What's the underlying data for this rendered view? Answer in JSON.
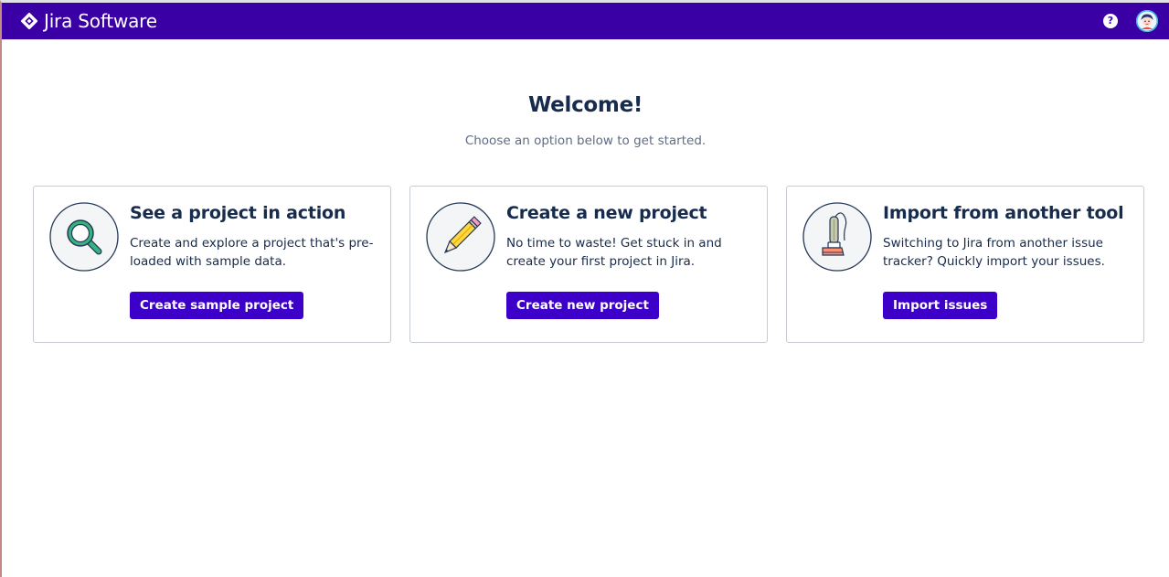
{
  "header": {
    "brand_label": "Jira Software",
    "brand_icon": "jira-diamond-icon",
    "help_icon": "question-circle-icon",
    "help_glyph": "?",
    "avatar_icon": "user-avatar-icon",
    "bar_color": "#3a00a6"
  },
  "main": {
    "title": "Welcome!",
    "subtitle": "Choose an option below to get started.",
    "cards": [
      {
        "icon": "magnifying-glass-icon",
        "title": "See a project in action",
        "description": "Create and explore a project that's pre-loaded with sample data.",
        "button_label": "Create sample project"
      },
      {
        "icon": "pencil-icon",
        "title": "Create a new project",
        "description": "No time to waste! Get stuck in and create your first project in Jira.",
        "button_label": "Create new project"
      },
      {
        "icon": "vacuum-cleaner-icon",
        "title": "Import from another tool",
        "description": "Switching to Jira from another issue tracker? Quickly import your issues.",
        "button_label": "Import issues"
      }
    ],
    "button_color": "#3d00c9"
  }
}
